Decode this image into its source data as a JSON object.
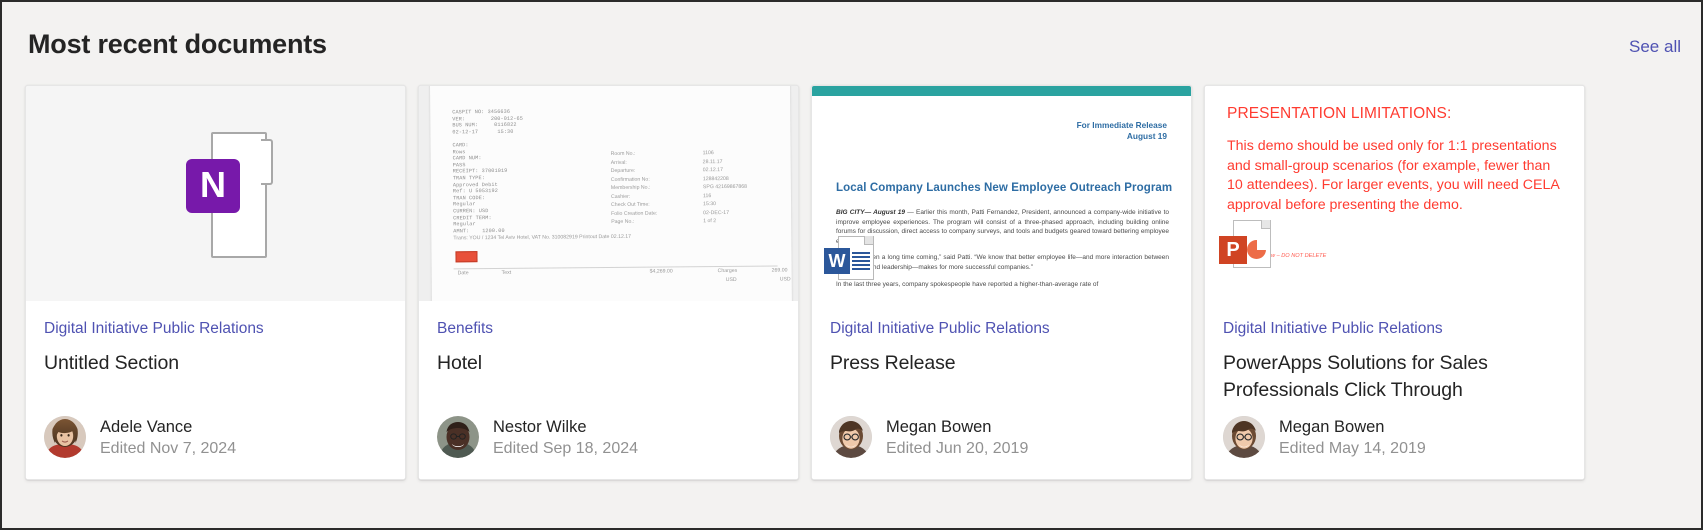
{
  "header": {
    "title": "Most recent documents",
    "see_all_label": "See all",
    "link_color": "#4f52b2",
    "title_color": "#242424",
    "background": "#f3f2f1"
  },
  "cards": [
    {
      "site": "Digital Initiative Public Relations",
      "title": "Untitled Section",
      "author": "Adele Vance",
      "edited": "Edited Nov 7, 2024",
      "thumbnail_kind": "onenote-placeholder",
      "app_icon": "onenote-icon",
      "app_letter": "N",
      "app_color": "#7719aa"
    },
    {
      "site": "Benefits",
      "title": "Hotel",
      "author": "Nestor Wilke",
      "edited": "Edited Sep 18, 2024",
      "thumbnail_kind": "scanned-receipt",
      "app_icon": "scanned-document-icon",
      "receipt": {
        "left_block": "CASPIT NO: 3456636\nVER:        200-012-65\nBUS NUM:     0116822\n02-12-17      15:30\n\nCARD:\nRows\nCARD NUM:\nPASS\nRECEIPT: 37001019\nTRAN TYPE:\nApproved Debit\nRef: U 5053192\nTRAN CODE:\nRegular\nCURREN: USD\nCREDIT TERM:\nRegular\nAMNT:    1200.00",
        "rows": [
          {
            "label": "Room No.:",
            "value": "1106"
          },
          {
            "label": "Arrival:",
            "value": "28.11.17"
          },
          {
            "label": "Departure:",
            "value": "02.12.17"
          },
          {
            "label": "Confirmation No:",
            "value": "128842208"
          },
          {
            "label": "Membership No.:",
            "value": "SPG    42169867868"
          },
          {
            "label": "Cashier:",
            "value": "116"
          },
          {
            "label": "Check Out Time:",
            "value": "15:30"
          },
          {
            "label": "Folio Creation Date:",
            "value": "02-DEC-17"
          },
          {
            "label": "Page No.:",
            "value": "1 of 2"
          }
        ],
        "sub_header": "Trans: YOU / 1234 Tel Aviv Hotel,     VAT No. 310082919     Printout Date        02.12.17",
        "footer_cols": [
          "Date",
          "Text",
          "$4,269.00",
          "Charges",
          "269.00"
        ],
        "footer_units": [
          "USD",
          "USD"
        ]
      }
    },
    {
      "site": "Digital Initiative Public Relations",
      "title": "Press Release",
      "author": "Megan Bowen",
      "edited": "Edited Jun 20, 2019",
      "thumbnail_kind": "word-press-release",
      "app_icon": "word-icon",
      "app_letter": "W",
      "app_color": "#2b579a",
      "band_color": "#2aa3a0",
      "release": {
        "release_line_1": "For Immediate Release",
        "release_line_2": "August 19",
        "headline": "Local Company Launches New Employee Outreach Program",
        "lead_in": "BIG CITY— August 19 ",
        "paragraph_1": "— Earlier this month, Patti Fernandez, President, announced a company-wide initiative to improve employee experiences. The program will consist of a three-phased approach, including building online forums for discussion, direct access to company surveys, and tools and budgets geared toward bettering employee experiences.",
        "paragraph_2": "“This has been a long time coming,” said Patti. “We know that better employee life—and more interaction between employees and leadership—makes for more successful companies.”",
        "paragraph_3": "In the last three years, company spokespeople have reported a higher-than-average rate of"
      }
    },
    {
      "site": "Digital Initiative Public Relations",
      "title": "PowerApps Solutions for Sales Professionals Click Through",
      "author": "Megan Bowen",
      "edited": "Edited May 14, 2019",
      "thumbnail_kind": "powerpoint-slide",
      "app_icon": "powerpoint-icon",
      "app_letter": "P",
      "app_color": "#d04423",
      "slide": {
        "heading": "PRESENTATION LIMITATIONS:",
        "body": "This demo should be used only for 1:1 presentations and small-group scenarios (for example, fewer than 10 attendees). For larger events, you will need CELA approval before presenting the demo.",
        "watermark": "w – DO NOT DELETE",
        "text_color": "#ff3b30"
      }
    }
  ]
}
